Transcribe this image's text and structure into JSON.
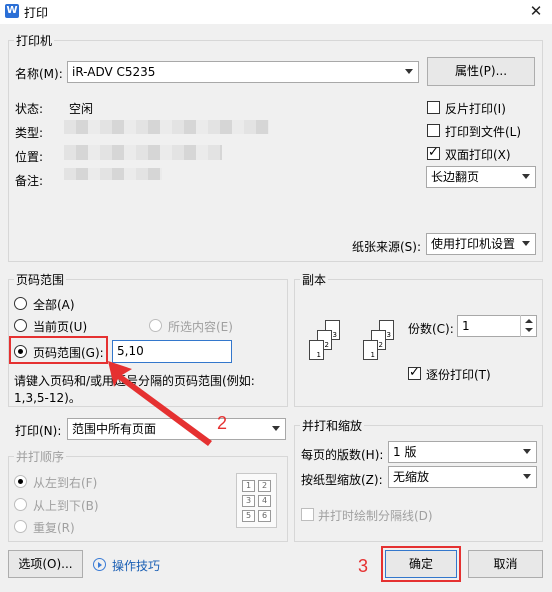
{
  "window": {
    "title": "打印",
    "app_icon_letter": "W"
  },
  "printer": {
    "group_title": "打印机",
    "name_label": "名称(M):",
    "name_value": "iR-ADV C5235",
    "properties_button": "属性(P)...",
    "status_label": "状态:",
    "status_value": "空闲",
    "type_label": "类型:",
    "location_label": "位置:",
    "comment_label": "备注:",
    "reverse_print": {
      "label": "反片打印(I)",
      "checked": false
    },
    "print_to_file": {
      "label": "打印到文件(L)",
      "checked": false
    },
    "duplex": {
      "label": "双面打印(X)",
      "checked": true
    },
    "flip_value": "长边翻页",
    "paper_source_label": "纸张来源(S):",
    "paper_source_value": "使用打印机设置"
  },
  "page_range": {
    "group_title": "页码范围",
    "all": "全部(A)",
    "current": "当前页(U)",
    "selection": "所选内容(E)",
    "range": "页码范围(G):",
    "range_value": "5,10",
    "hint_line1": "请键入页码和/或用逗号分隔的页码范围(例如:",
    "hint_line2": "1,3,5-12)。",
    "selected": "range"
  },
  "print_what": {
    "label": "打印(N):",
    "value": "范围中所有页面"
  },
  "collate_order": {
    "group_title": "并打顺序",
    "options": [
      "从左到右(F)",
      "从上到下(B)",
      "重复(R)"
    ],
    "preview_numbers": [
      "1",
      "2",
      "3",
      "4",
      "5",
      "6"
    ]
  },
  "copies": {
    "group_title": "副本",
    "count_label": "份数(C):",
    "count_value": "1",
    "collate": {
      "label": "逐份打印(T)",
      "checked": true
    },
    "stack_numbers": [
      "1",
      "2",
      "3"
    ]
  },
  "zoom": {
    "group_title": "并打和缩放",
    "pages_per_sheet_label": "每页的版数(H):",
    "pages_per_sheet_value": "1 版",
    "scale_label": "按纸型缩放(Z):",
    "scale_value": "无缩放",
    "draw_lines": {
      "label": "并打时绘制分隔线(D)",
      "checked": false
    }
  },
  "footer": {
    "options_button": "选项(O)...",
    "tips_link": "操作技巧",
    "ok_button": "确定",
    "cancel_button": "取消"
  },
  "annotations": {
    "step2": "2",
    "step3": "3"
  },
  "colors": {
    "annotation_red": "#e53131",
    "focus_blue": "#3377cc"
  }
}
